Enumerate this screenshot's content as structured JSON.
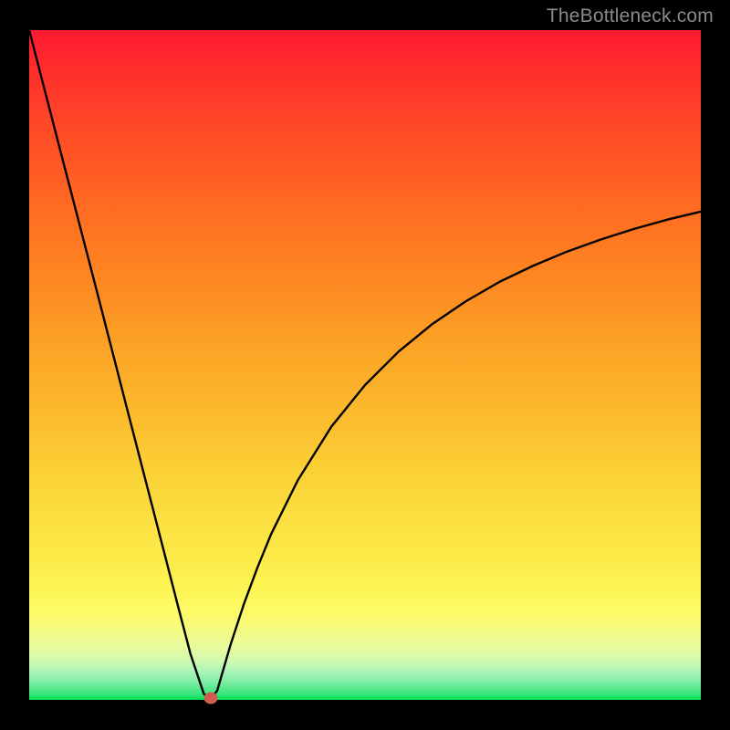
{
  "watermark": "TheBottleneck.com",
  "chart_data": {
    "type": "line",
    "title": "",
    "xlabel": "",
    "ylabel": "",
    "xlim": [
      0,
      100
    ],
    "ylim": [
      0,
      100
    ],
    "background": "heatmap_red_to_green_vertical",
    "series": [
      {
        "name": "bottleneck-curve",
        "x": [
          0,
          5,
          10,
          15,
          20,
          22,
          24,
          26,
          27,
          28,
          30,
          32,
          34,
          36,
          40,
          45,
          50,
          55,
          60,
          65,
          70,
          75,
          80,
          85,
          90,
          95,
          100
        ],
        "values": [
          100,
          80.6,
          61.3,
          41.8,
          22.4,
          14.6,
          6.9,
          0.9,
          0.1,
          1.4,
          8.3,
          14.4,
          19.8,
          24.7,
          32.8,
          40.8,
          47.0,
          52.0,
          56.1,
          59.5,
          62.4,
          64.8,
          66.9,
          68.7,
          70.3,
          71.7,
          72.9
        ]
      }
    ],
    "marker": {
      "x": 27,
      "y": 0.3,
      "color": "#d05d50"
    }
  }
}
